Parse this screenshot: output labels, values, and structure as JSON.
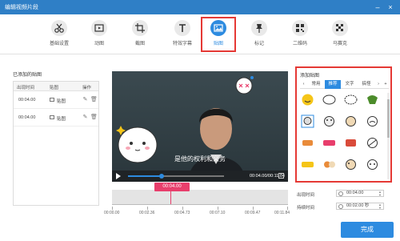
{
  "window": {
    "title": "编辑视频片段",
    "minimize_glyph": "–",
    "close_glyph": "×"
  },
  "toolbar": {
    "items": [
      {
        "label": "基础设置",
        "icon": "scissors-icon"
      },
      {
        "label": "动图",
        "icon": "gif-frame-icon"
      },
      {
        "label": "截图",
        "icon": "crop-icon"
      },
      {
        "label": "特效字幕",
        "icon": "text-icon"
      },
      {
        "label": "贴图",
        "icon": "picture-icon",
        "active": true
      },
      {
        "label": "标记",
        "icon": "pin-icon"
      },
      {
        "label": "二维码",
        "icon": "qrcode-icon"
      },
      {
        "label": "马赛克",
        "icon": "mosaic-icon"
      }
    ]
  },
  "left_panel": {
    "title": "已添加的贴图",
    "columns": [
      "出现时间",
      "贴图",
      "操作"
    ],
    "rows": [
      {
        "time": "00:04.00",
        "type": "贴图"
      },
      {
        "time": "00:04.00",
        "type": "贴图"
      }
    ]
  },
  "player": {
    "subtitle": "是他的权利和义务",
    "time_display": "00:04.00/00:11.84",
    "progress": 0.35
  },
  "timeline": {
    "marker_label": "00:04.00",
    "ticks": [
      "00:00.00",
      "00:02.36",
      "00:04.73",
      "00:07.10",
      "00:09.47",
      "00:11.84"
    ]
  },
  "sticker_panel": {
    "title": "添加贴图",
    "prev_glyph": "‹",
    "next_glyph": "›",
    "add_glyph": "+",
    "tabs": [
      "常用",
      "推荐",
      "文字",
      "搞怪"
    ],
    "active_tab": "推荐"
  },
  "fields": {
    "appear_label": "出现时间",
    "appear_value": "00:04.00",
    "duration_label": "持续时间",
    "duration_value": "00:02.00 秒"
  },
  "done_label": "完成",
  "colors": {
    "accent": "#2d8be0",
    "titlebar": "#2f7fc6",
    "highlight": "#e53935",
    "marker": "#e83e6c"
  }
}
